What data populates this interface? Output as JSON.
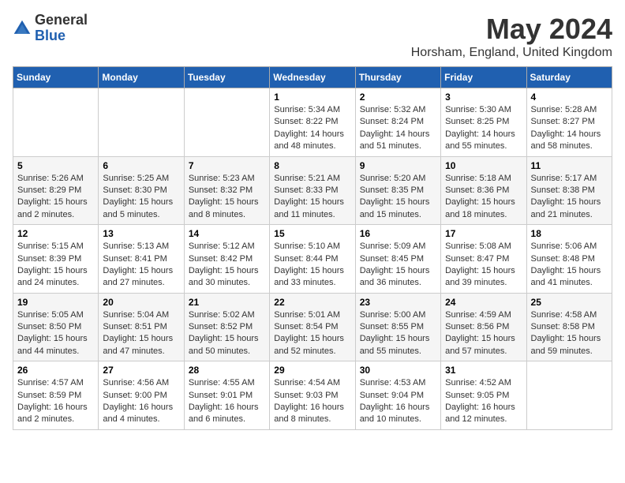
{
  "logo": {
    "general": "General",
    "blue": "Blue"
  },
  "header": {
    "title": "May 2024",
    "subtitle": "Horsham, England, United Kingdom"
  },
  "weekdays": [
    "Sunday",
    "Monday",
    "Tuesday",
    "Wednesday",
    "Thursday",
    "Friday",
    "Saturday"
  ],
  "weeks": [
    [
      {
        "day": "",
        "info": ""
      },
      {
        "day": "",
        "info": ""
      },
      {
        "day": "",
        "info": ""
      },
      {
        "day": "1",
        "info": "Sunrise: 5:34 AM\nSunset: 8:22 PM\nDaylight: 14 hours\nand 48 minutes."
      },
      {
        "day": "2",
        "info": "Sunrise: 5:32 AM\nSunset: 8:24 PM\nDaylight: 14 hours\nand 51 minutes."
      },
      {
        "day": "3",
        "info": "Sunrise: 5:30 AM\nSunset: 8:25 PM\nDaylight: 14 hours\nand 55 minutes."
      },
      {
        "day": "4",
        "info": "Sunrise: 5:28 AM\nSunset: 8:27 PM\nDaylight: 14 hours\nand 58 minutes."
      }
    ],
    [
      {
        "day": "5",
        "info": "Sunrise: 5:26 AM\nSunset: 8:29 PM\nDaylight: 15 hours\nand 2 minutes."
      },
      {
        "day": "6",
        "info": "Sunrise: 5:25 AM\nSunset: 8:30 PM\nDaylight: 15 hours\nand 5 minutes."
      },
      {
        "day": "7",
        "info": "Sunrise: 5:23 AM\nSunset: 8:32 PM\nDaylight: 15 hours\nand 8 minutes."
      },
      {
        "day": "8",
        "info": "Sunrise: 5:21 AM\nSunset: 8:33 PM\nDaylight: 15 hours\nand 11 minutes."
      },
      {
        "day": "9",
        "info": "Sunrise: 5:20 AM\nSunset: 8:35 PM\nDaylight: 15 hours\nand 15 minutes."
      },
      {
        "day": "10",
        "info": "Sunrise: 5:18 AM\nSunset: 8:36 PM\nDaylight: 15 hours\nand 18 minutes."
      },
      {
        "day": "11",
        "info": "Sunrise: 5:17 AM\nSunset: 8:38 PM\nDaylight: 15 hours\nand 21 minutes."
      }
    ],
    [
      {
        "day": "12",
        "info": "Sunrise: 5:15 AM\nSunset: 8:39 PM\nDaylight: 15 hours\nand 24 minutes."
      },
      {
        "day": "13",
        "info": "Sunrise: 5:13 AM\nSunset: 8:41 PM\nDaylight: 15 hours\nand 27 minutes."
      },
      {
        "day": "14",
        "info": "Sunrise: 5:12 AM\nSunset: 8:42 PM\nDaylight: 15 hours\nand 30 minutes."
      },
      {
        "day": "15",
        "info": "Sunrise: 5:10 AM\nSunset: 8:44 PM\nDaylight: 15 hours\nand 33 minutes."
      },
      {
        "day": "16",
        "info": "Sunrise: 5:09 AM\nSunset: 8:45 PM\nDaylight: 15 hours\nand 36 minutes."
      },
      {
        "day": "17",
        "info": "Sunrise: 5:08 AM\nSunset: 8:47 PM\nDaylight: 15 hours\nand 39 minutes."
      },
      {
        "day": "18",
        "info": "Sunrise: 5:06 AM\nSunset: 8:48 PM\nDaylight: 15 hours\nand 41 minutes."
      }
    ],
    [
      {
        "day": "19",
        "info": "Sunrise: 5:05 AM\nSunset: 8:50 PM\nDaylight: 15 hours\nand 44 minutes."
      },
      {
        "day": "20",
        "info": "Sunrise: 5:04 AM\nSunset: 8:51 PM\nDaylight: 15 hours\nand 47 minutes."
      },
      {
        "day": "21",
        "info": "Sunrise: 5:02 AM\nSunset: 8:52 PM\nDaylight: 15 hours\nand 50 minutes."
      },
      {
        "day": "22",
        "info": "Sunrise: 5:01 AM\nSunset: 8:54 PM\nDaylight: 15 hours\nand 52 minutes."
      },
      {
        "day": "23",
        "info": "Sunrise: 5:00 AM\nSunset: 8:55 PM\nDaylight: 15 hours\nand 55 minutes."
      },
      {
        "day": "24",
        "info": "Sunrise: 4:59 AM\nSunset: 8:56 PM\nDaylight: 15 hours\nand 57 minutes."
      },
      {
        "day": "25",
        "info": "Sunrise: 4:58 AM\nSunset: 8:58 PM\nDaylight: 15 hours\nand 59 minutes."
      }
    ],
    [
      {
        "day": "26",
        "info": "Sunrise: 4:57 AM\nSunset: 8:59 PM\nDaylight: 16 hours\nand 2 minutes."
      },
      {
        "day": "27",
        "info": "Sunrise: 4:56 AM\nSunset: 9:00 PM\nDaylight: 16 hours\nand 4 minutes."
      },
      {
        "day": "28",
        "info": "Sunrise: 4:55 AM\nSunset: 9:01 PM\nDaylight: 16 hours\nand 6 minutes."
      },
      {
        "day": "29",
        "info": "Sunrise: 4:54 AM\nSunset: 9:03 PM\nDaylight: 16 hours\nand 8 minutes."
      },
      {
        "day": "30",
        "info": "Sunrise: 4:53 AM\nSunset: 9:04 PM\nDaylight: 16 hours\nand 10 minutes."
      },
      {
        "day": "31",
        "info": "Sunrise: 4:52 AM\nSunset: 9:05 PM\nDaylight: 16 hours\nand 12 minutes."
      },
      {
        "day": "",
        "info": ""
      }
    ]
  ]
}
